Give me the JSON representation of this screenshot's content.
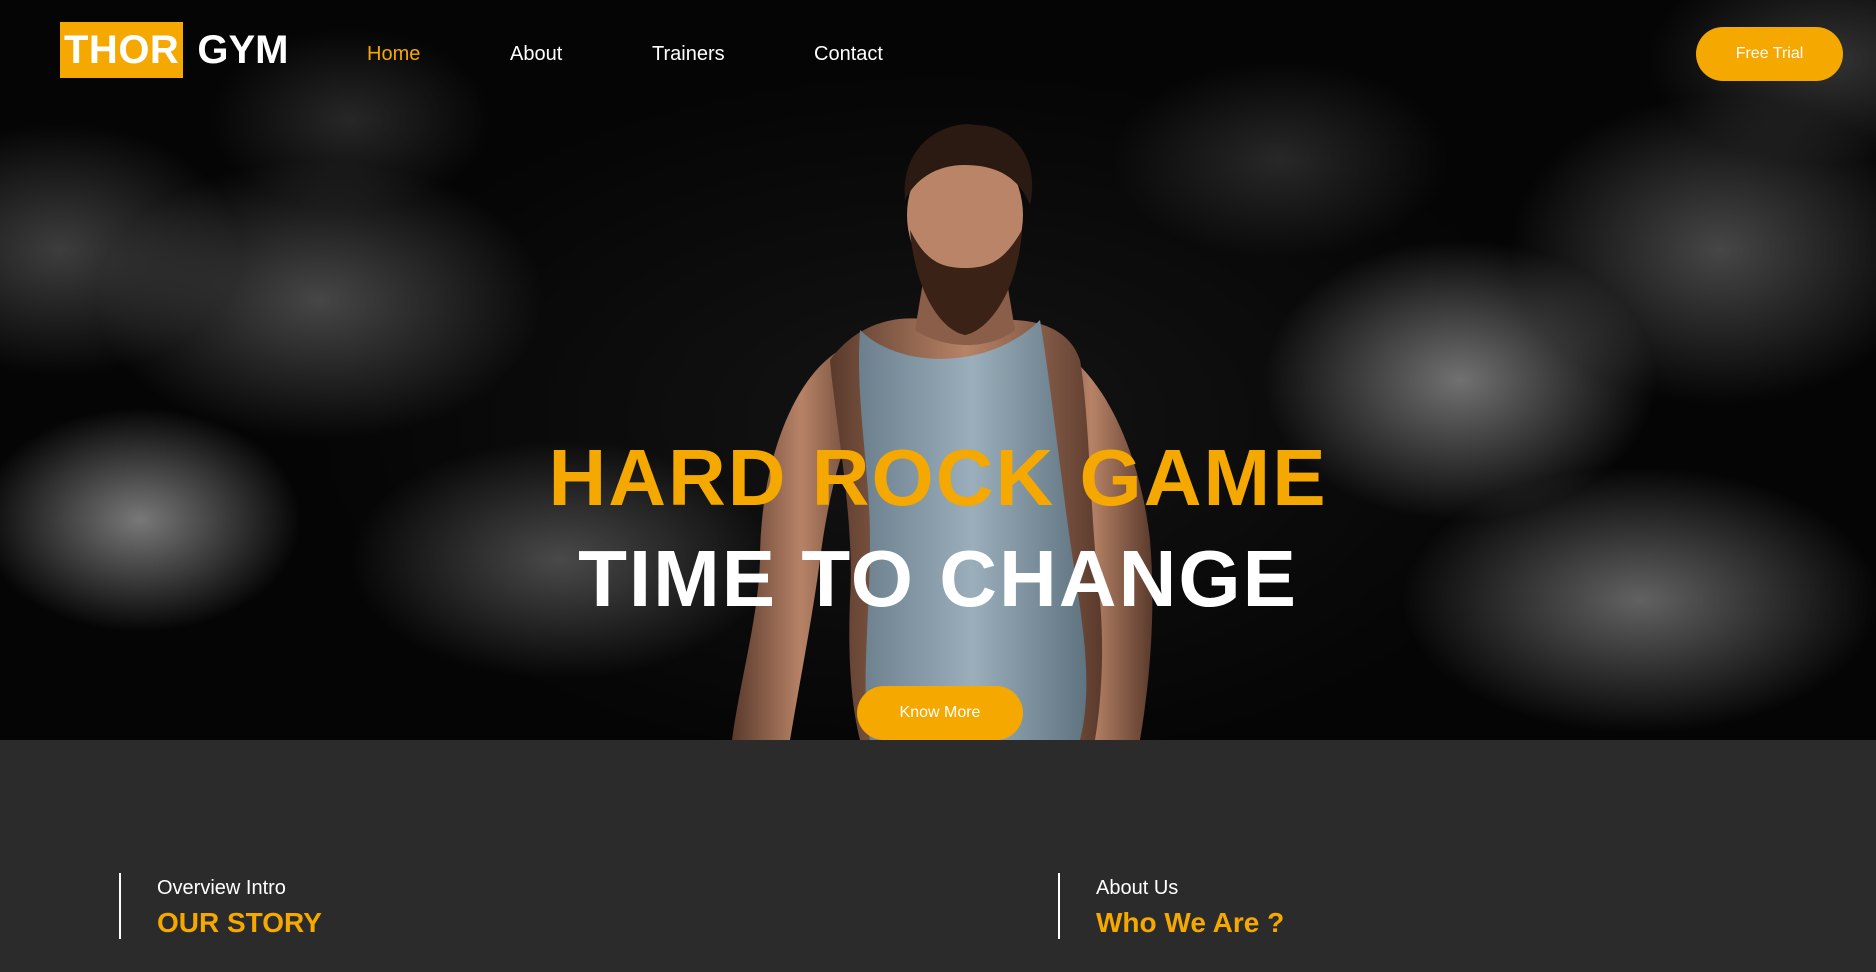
{
  "brand": {
    "logo_highlight": "THOR",
    "logo_rest": "GYM",
    "accent_color": "#f5a800"
  },
  "nav": {
    "items": [
      {
        "label": "Home",
        "active": true
      },
      {
        "label": "About",
        "active": false
      },
      {
        "label": "Trainers",
        "active": false
      },
      {
        "label": "Contact",
        "active": false
      }
    ],
    "cta_label": "Free Trial"
  },
  "hero": {
    "headline_1": "HARD ROCK GAME",
    "headline_2": "TIME TO CHANGE",
    "button_label": "Know More",
    "image": "muscular-man-in-tank-top"
  },
  "sections": [
    {
      "kicker": "Overview Intro",
      "title": "OUR STORY"
    },
    {
      "kicker": "About Us",
      "title": "Who We Are ?"
    }
  ]
}
